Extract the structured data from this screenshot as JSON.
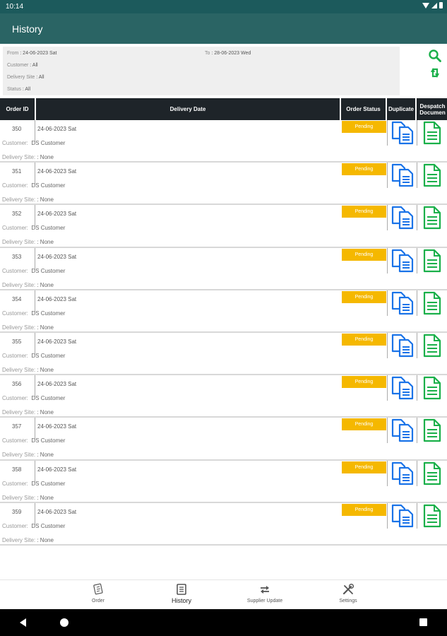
{
  "status_bar": {
    "time": "10:14"
  },
  "app_bar": {
    "title": "History"
  },
  "filters": {
    "from": {
      "label": "From",
      "value": ": 24-06-2023 Sat"
    },
    "to": {
      "label": "To",
      "value": ": 28-06-2023 Wed"
    },
    "customer": {
      "label": "Customer",
      "value": ": All"
    },
    "delivery_site": {
      "label": "Delivery Site",
      "value": ": All"
    },
    "status": {
      "label": "Status",
      "value": ": All"
    }
  },
  "actions": {
    "search_icon": "search-icon",
    "refresh_icon": "refresh-icon",
    "color": "#1ab04a"
  },
  "table": {
    "headers": [
      "Order ID",
      "Delivery Date",
      "Order Status",
      "Duplicate",
      "Despatch Documen"
    ],
    "customer_label": "Customer:",
    "site_label": "Delivery Site:",
    "rows": [
      {
        "id": "350",
        "date": "24-06-2023 Sat",
        "customer": "DS Customer",
        "site": ": None",
        "status": "Pending"
      },
      {
        "id": "351",
        "date": "24-06-2023 Sat",
        "customer": "DS Customer",
        "site": ": None",
        "status": "Pending"
      },
      {
        "id": "352",
        "date": "24-06-2023 Sat",
        "customer": "DS Customer",
        "site": ": None",
        "status": "Pending"
      },
      {
        "id": "353",
        "date": "24-06-2023 Sat",
        "customer": "DS Customer",
        "site": ": None",
        "status": "Pending"
      },
      {
        "id": "354",
        "date": "24-06-2023 Sat",
        "customer": "DS Customer",
        "site": ": None",
        "status": "Pending"
      },
      {
        "id": "355",
        "date": "24-06-2023 Sat",
        "customer": "DS Customer",
        "site": ": None",
        "status": "Pending"
      },
      {
        "id": "356",
        "date": "24-06-2023 Sat",
        "customer": "DS Customer",
        "site": ": None",
        "status": "Pending"
      },
      {
        "id": "357",
        "date": "24-06-2023 Sat",
        "customer": "DS Customer",
        "site": ": None",
        "status": "Pending"
      },
      {
        "id": "358",
        "date": "24-06-2023 Sat",
        "customer": "DS Customer",
        "site": ": None",
        "status": "Pending"
      },
      {
        "id": "359",
        "date": "24-06-2023 Sat",
        "customer": "DS Customer",
        "site": ": None",
        "status": "Pending"
      }
    ]
  },
  "bottom_nav": {
    "items": [
      {
        "label": "Order",
        "icon": "order-icon"
      },
      {
        "label": "History",
        "icon": "history-icon",
        "active": true
      },
      {
        "label": "Supplier Update",
        "icon": "sync-icon"
      },
      {
        "label": "Settings",
        "icon": "settings-icon"
      }
    ]
  },
  "colors": {
    "status_bar": "#1c5a5c",
    "app_bar": "#2a6464",
    "table_header": "#1e2429",
    "pending": "#f5b800",
    "duplicate_icon": "#1a73e8",
    "despatch_icon": "#1ab04a"
  }
}
